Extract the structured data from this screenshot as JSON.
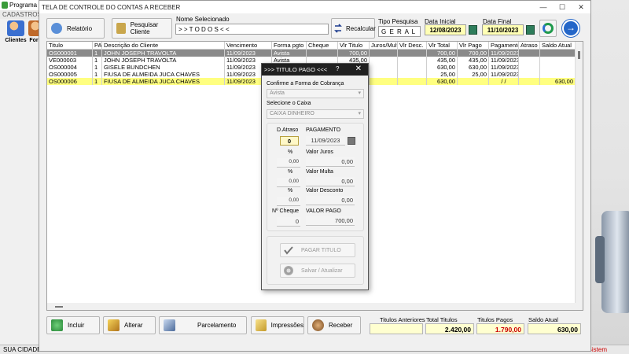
{
  "background": {
    "title": "Programa C",
    "menu": "CADASTROS",
    "tools": [
      {
        "label": "Clientes"
      },
      {
        "label": "For"
      }
    ],
    "status_left": "SUA CIDADE -",
    "status_right": "Sistem"
  },
  "window": {
    "title": "TELA DE CONTROLE DO CONTAS A RECEBER",
    "controls": {
      "minimize": "—",
      "maximize": "☐",
      "close": "✕"
    }
  },
  "toolbar": {
    "relatorio": "Relatório",
    "pesquisar_cliente": "Pesquisar Cliente",
    "nome_selecionado_label": "Nome Selecionado",
    "nome_selecionado_value": "> > T O D O S < <",
    "recalcular": "Recalcular",
    "tipo_pesquisa_label": "Tipo Pesquisa",
    "tipo_pesquisa_value": "G E R A L",
    "data_inicial_label": "Data Inicial",
    "data_inicial_value": "12/08/2023",
    "data_final_label": "Data Final",
    "data_final_value": "11/10/2023"
  },
  "grid": {
    "columns": [
      "Titulo",
      "PA",
      "Descrição do Cliente",
      "Vencimento",
      "Forma pgto",
      "Cheque",
      "Vlr Titulo",
      "Juros/Multa",
      "Vlr Desc.",
      "Vlr Total",
      "Vlr Pago",
      "Pagamento",
      "Atraso",
      "Saldo Atual"
    ],
    "rows": [
      {
        "style": "gray",
        "cells": [
          "OS000001",
          "1",
          "JOHN JOSEPH TRAVOLTA",
          "11/09/2023",
          "Avista",
          "",
          "700,00",
          "",
          "",
          "700,00",
          "700,00",
          "11/09/2023",
          "",
          ""
        ]
      },
      {
        "style": "white",
        "cells": [
          "VE000003",
          "1",
          "JOHN JOSEPH TRAVOLTA",
          "11/09/2023",
          "Avista",
          "",
          "435,00",
          "",
          "",
          "435,00",
          "435,00",
          "11/09/2023",
          "",
          ""
        ]
      },
      {
        "style": "white",
        "cells": [
          "OS000004",
          "1",
          "GISELE BUNDCHEN",
          "11/09/2023",
          "Avista",
          "",
          "630,00",
          "",
          "",
          "630,00",
          "630,00",
          "11/09/2023",
          "",
          ""
        ]
      },
      {
        "style": "white",
        "cells": [
          "OS000005",
          "1",
          "FIUSA DE ALMEIDA JUCA CHAVES",
          "11/09/2023",
          "A",
          "",
          "",
          "",
          "",
          "25,00",
          "25,00",
          "11/09/2023",
          "",
          ""
        ]
      },
      {
        "style": "yellow",
        "cells": [
          "OS000006",
          "1",
          "FIUSA DE ALMEIDA JUCA CHAVES",
          "11/09/2023",
          "A",
          "",
          "",
          "",
          "",
          "630,00",
          "",
          "/ /",
          "",
          "630,00"
        ]
      }
    ]
  },
  "bottom": {
    "incluir": "Incluir",
    "alterar": "Alterar",
    "parcelamento": "Parcelamento",
    "impressoes": "Impressões",
    "receber": "Receber",
    "titulos_anteriores_label": "Titulos Anteriores",
    "titulos_anteriores_value": "",
    "total_titulos_label": "Total Titulos",
    "total_titulos_value": "2.420,00",
    "titulos_pagos_label": "Titulos Pagos",
    "titulos_pagos_value": "1.790,00",
    "saldo_atual_label": "Saldo Atual",
    "saldo_atual_value": "630,00"
  },
  "modal": {
    "title": ">>> TITULO PAGO <<<",
    "help": "?",
    "close": "✕",
    "forma_label": "Confirme a Forma de Cobrança",
    "forma_value": "Avista",
    "caixa_label": "Selecione o Caixa",
    "caixa_value": "CAIXA DINHEIRO",
    "d_atraso_label": "D.Atraso",
    "d_atraso_value": "0",
    "pagamento_label": "PAGAMENTO",
    "pagamento_value": "11/09/2023",
    "pct_label": "%",
    "juros_pct": "0,00",
    "valor_juros_label": "Valor Juros",
    "valor_juros": "0,00",
    "multa_pct": "0,00",
    "valor_multa_label": "Valor Multa",
    "valor_multa": "0,00",
    "desconto_pct": "0,00",
    "valor_desconto_label": "Valor Desconto",
    "valor_desconto": "0,00",
    "n_cheque_label": "Nº Cheque",
    "n_cheque_value": "0",
    "valor_pago_label": "VALOR PAGO",
    "valor_pago_value": "700,00",
    "pagar_titulo": "PAGAR TITULO",
    "salvar_atualizar": "Salvar / Atualizar"
  },
  "colors": {
    "selected_row": "#ffff80",
    "gray_row": "#8a8a8a",
    "modal_title": "#202020",
    "titulos_pagos": "#cc0000",
    "saldo": "#000000"
  }
}
